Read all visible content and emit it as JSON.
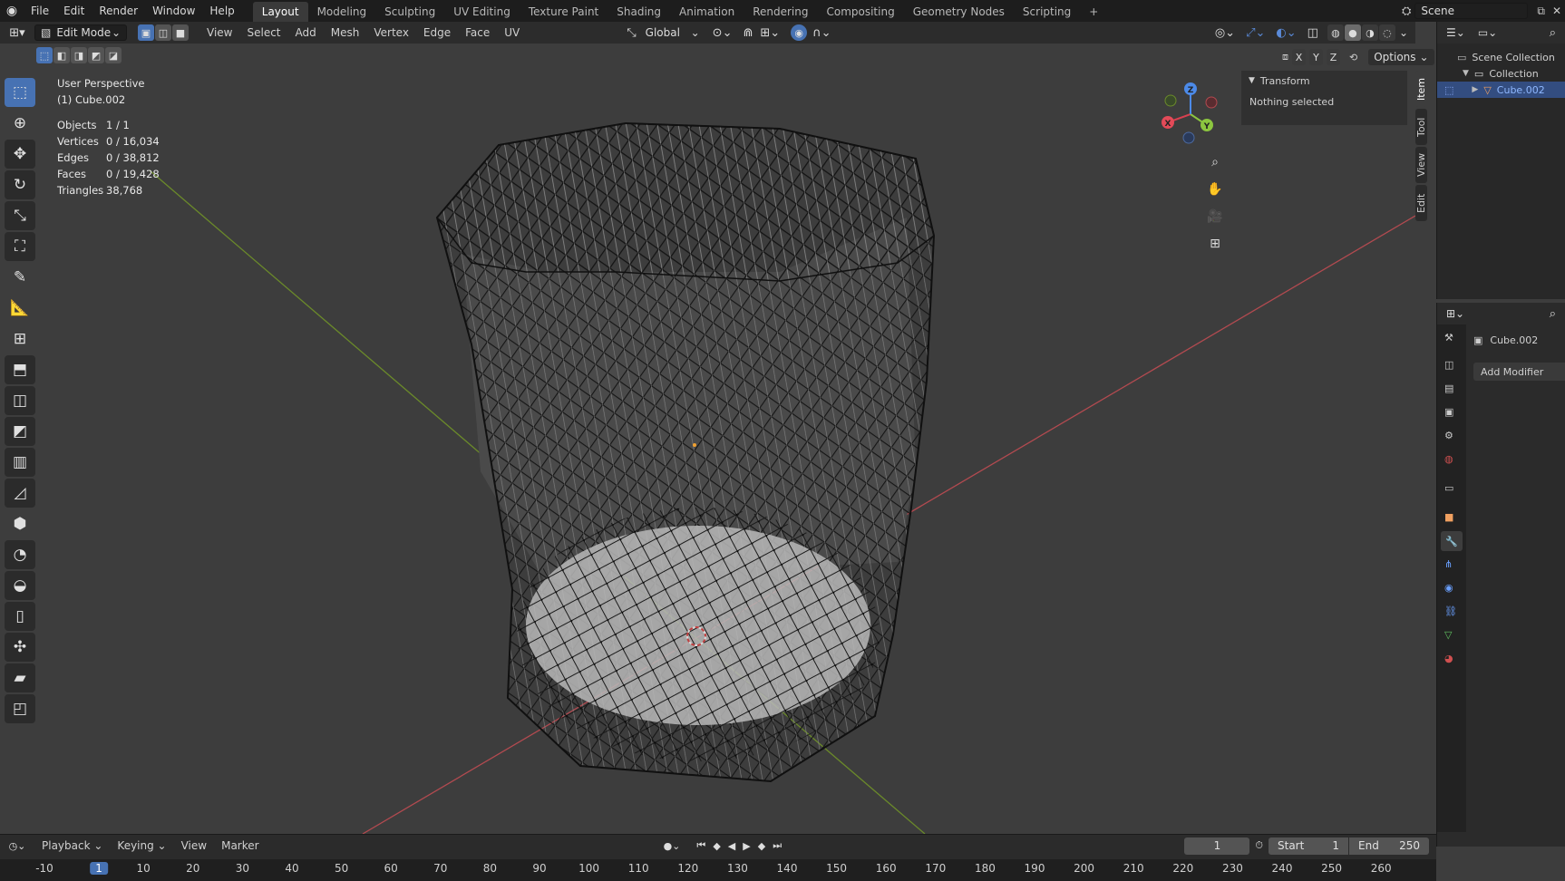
{
  "topbar": {
    "menus": [
      "File",
      "Edit",
      "Render",
      "Window",
      "Help"
    ],
    "workspaces": [
      "Layout",
      "Modeling",
      "Sculpting",
      "UV Editing",
      "Texture Paint",
      "Shading",
      "Animation",
      "Rendering",
      "Compositing",
      "Geometry Nodes",
      "Scripting"
    ],
    "active_workspace": "Layout",
    "add_tab": "+",
    "scene_name": "Scene"
  },
  "header": {
    "mode": "Edit Mode",
    "menus": [
      "View",
      "Select",
      "Add",
      "Mesh",
      "Vertex",
      "Edge",
      "Face",
      "UV"
    ],
    "orientation": "Global",
    "options": "Options",
    "axes": [
      "X",
      "Y",
      "Z"
    ]
  },
  "viewport": {
    "view_name": "User Perspective",
    "object_name": "(1) Cube.002",
    "stats": [
      {
        "label": "Objects",
        "value": "1 / 1"
      },
      {
        "label": "Vertices",
        "value": "0 / 16,034"
      },
      {
        "label": "Edges",
        "value": "0 / 38,812"
      },
      {
        "label": "Faces",
        "value": "0 / 19,428"
      },
      {
        "label": "Triangles",
        "value": "38,768"
      }
    ],
    "gizmo_axes": {
      "x": "X",
      "y": "Y",
      "z": "Z"
    },
    "colors": {
      "x_axis": "#e34a58",
      "y_axis": "#8cc63f",
      "z_axis": "#4c8ae8",
      "background": "#3d3d3d",
      "select": "#4772b3"
    }
  },
  "npanel": {
    "section": "Transform",
    "message": "Nothing selected",
    "tabs": [
      "Item",
      "Tool",
      "View",
      "Edit"
    ]
  },
  "outliner": {
    "scene_collection": "Scene Collection",
    "collection": "Collection",
    "object": "Cube.002"
  },
  "properties": {
    "object": "Cube.002",
    "add_modifier": "Add Modifier"
  },
  "timeline": {
    "menus": [
      "Playback",
      "Keying",
      "View",
      "Marker"
    ],
    "current_frame": "1",
    "start_label": "Start",
    "start_value": "1",
    "end_label": "End",
    "end_value": "250",
    "ruler": [
      "-10",
      "1",
      "10",
      "20",
      "30",
      "40",
      "50",
      "60",
      "70",
      "80",
      "90",
      "100",
      "110",
      "120",
      "130",
      "140",
      "150",
      "160",
      "170",
      "180",
      "190",
      "200",
      "210",
      "220",
      "230",
      "240",
      "250",
      "260"
    ]
  }
}
